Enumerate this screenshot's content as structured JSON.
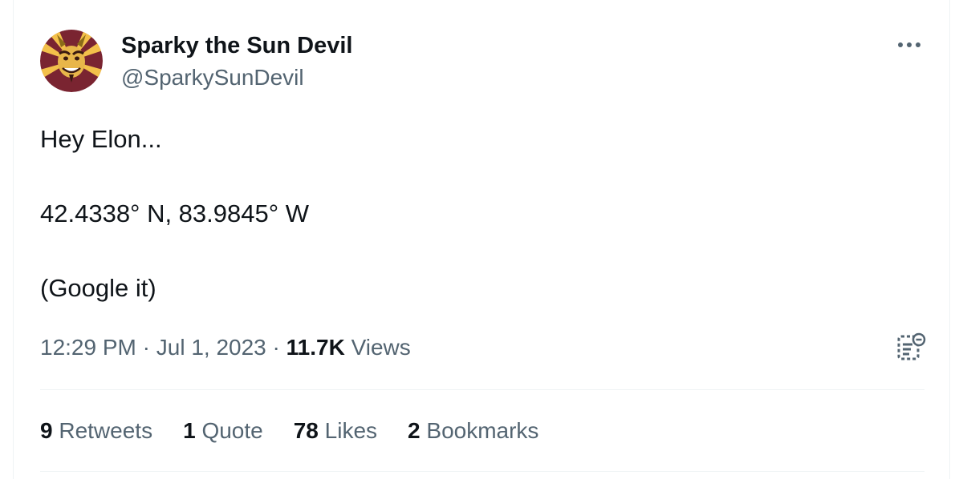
{
  "author": {
    "display_name": "Sparky the Sun Devil",
    "handle": "@SparkySunDevil",
    "avatar_icon": "sun-devil-mascot-avatar"
  },
  "tweet": {
    "lines": [
      "Hey Elon...",
      "42.4338° N, 83.9845° W",
      "(Google it)"
    ]
  },
  "meta": {
    "time": "12:29 PM",
    "separator": "·",
    "date": "Jul 1, 2023",
    "views_count": "11.7K",
    "views_label": "Views"
  },
  "stats": [
    {
      "count": "9",
      "label": "Retweets"
    },
    {
      "count": "1",
      "label": "Quote"
    },
    {
      "count": "78",
      "label": "Likes"
    },
    {
      "count": "2",
      "label": "Bookmarks"
    }
  ],
  "icons": {
    "more": "more-horizontal-icon",
    "analytics": "analytics-icon"
  },
  "colors": {
    "primary_text": "#0f1419",
    "secondary_text": "#536471",
    "divider": "#eff3f4",
    "avatar_maroon": "#7a2431",
    "avatar_gold": "#f3c04a"
  }
}
